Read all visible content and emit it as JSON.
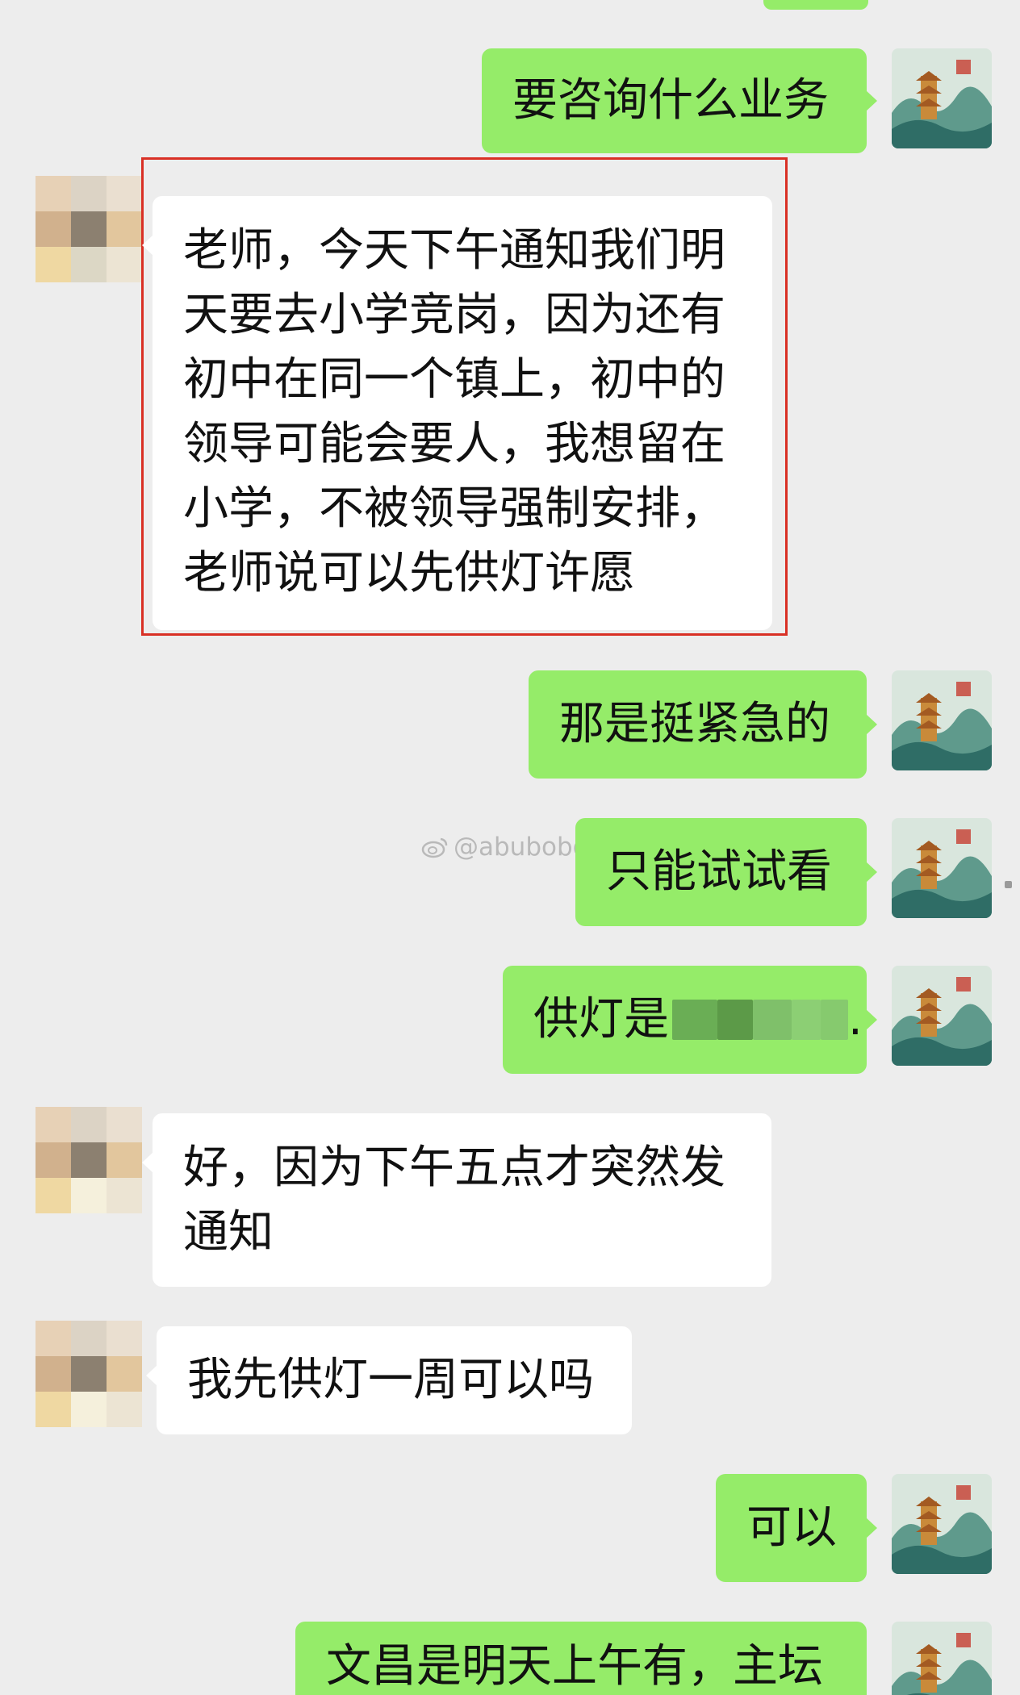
{
  "watermark": {
    "text": "@abubobo"
  },
  "colors": {
    "outgoing_bubble": "#95ec69",
    "incoming_bubble": "#ffffff",
    "background": "#ededed",
    "highlight": "#d93025"
  },
  "messages": [
    {
      "sender": "me",
      "text": "要咨询什么业务"
    },
    {
      "sender": "other",
      "lines": [
        "老师，今天下午通知我们明",
        "天要去小学竞岗，因为还有",
        "初中在同一个镇上，初中的",
        "领导可能会要人，我想留在",
        "小学，不被领导强制安排，",
        "老师说可以先供灯许愿"
      ]
    },
    {
      "sender": "me",
      "text": "那是挺紧急的"
    },
    {
      "sender": "me",
      "text": "只能试试看"
    },
    {
      "sender": "me",
      "text": "供灯是",
      "suffix": "."
    },
    {
      "sender": "other",
      "lines": [
        "好，因为下午五点才突然发",
        "通知"
      ]
    },
    {
      "sender": "other",
      "text": "我先供灯一周可以吗"
    },
    {
      "sender": "me",
      "text": "可以"
    },
    {
      "sender": "me",
      "text": "文昌是明天上午有，主坛"
    }
  ]
}
